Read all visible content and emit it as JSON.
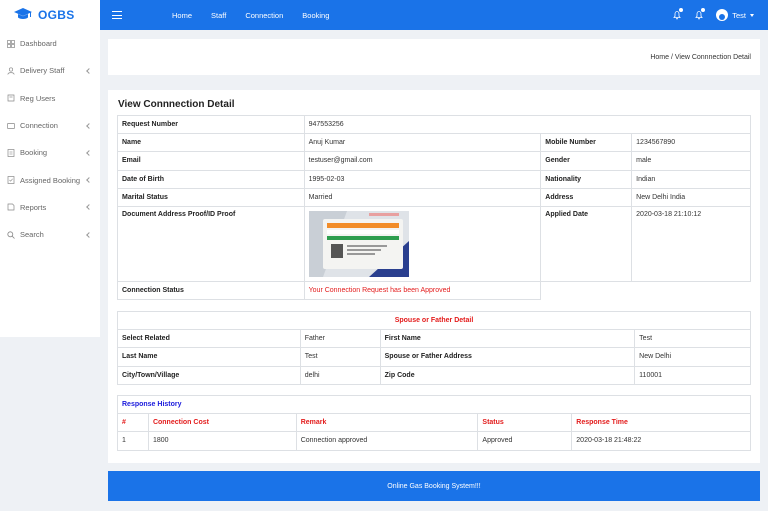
{
  "brand": {
    "name": "OGBS"
  },
  "nav": {
    "home": "Home",
    "staff": "Staff",
    "connection": "Connection",
    "booking": "Booking"
  },
  "user": {
    "name": "Test"
  },
  "sidebar": {
    "items": [
      {
        "label": "Dashboard"
      },
      {
        "label": "Delivery Staff"
      },
      {
        "label": "Reg Users"
      },
      {
        "label": "Connection"
      },
      {
        "label": "Booking"
      },
      {
        "label": "Assigned Booking"
      },
      {
        "label": "Reports"
      },
      {
        "label": "Search"
      }
    ]
  },
  "breadcrumb": {
    "text": "Home / View Connnection Detail"
  },
  "page": {
    "title": "View Connnection Detail"
  },
  "detail": {
    "request_number_label": "Request Number",
    "request_number": "947553256",
    "name_label": "Name",
    "name": "Anuj Kumar",
    "mobile_label": "Mobile Number",
    "mobile": "1234567890",
    "email_label": "Email",
    "email": "testuser@gmail.com",
    "gender_label": "Gender",
    "gender": "male",
    "dob_label": "Date of Birth",
    "dob": "1995-02-03",
    "nationality_label": "Nationality",
    "nationality": "Indian",
    "marital_label": "Marital Status",
    "marital": "Married",
    "address_label": "Address",
    "address": "New Delhi India",
    "proof_label": "Document Address Proof/ID Proof",
    "applied_label": "Applied Date",
    "applied": "2020-03-18 21:10:12",
    "status_label": "Connection Status",
    "status": "Your Connection Request has been Approved"
  },
  "spouse": {
    "heading": "Spouse or Father Detail",
    "select_related_label": "Select Related",
    "select_related": "Father",
    "first_name_label": "First Name",
    "first_name": "Test",
    "last_name_label": "Last Name",
    "last_name": "Test",
    "address_label": "Spouse or Father Address",
    "address": "New Delhi",
    "city_label": "City/Town/Village",
    "city": "delhi",
    "zip_label": "Zip Code",
    "zip": "110001"
  },
  "history": {
    "heading": "Response History",
    "columns": [
      "#",
      "Connection Cost",
      "Remark",
      "Status",
      "Response Time"
    ],
    "rows": [
      [
        "1",
        "1800",
        "Connection approved",
        "Approved",
        "2020-03-18 21:48:22"
      ]
    ]
  },
  "footer": {
    "text": "Online Gas Booking System!!!"
  },
  "colors": {
    "primary": "#1a73e8",
    "danger": "#e31c1c",
    "link": "#1a1adc"
  }
}
